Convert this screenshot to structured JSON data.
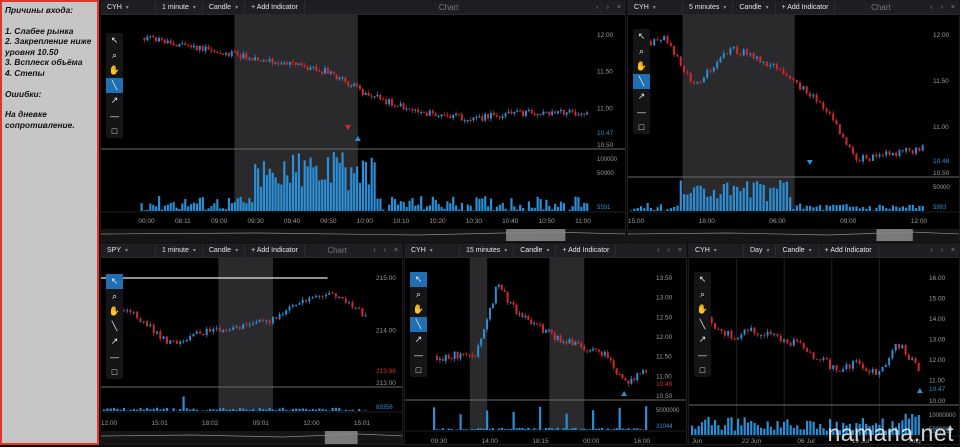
{
  "notes": {
    "heading": "Причины входа:",
    "items": [
      "1. Слабее рынка",
      "2. Закрепление ниже уровня 10.50",
      "3. Всплеск объёма",
      "4. Степы"
    ],
    "errors_heading": "Ошибки:",
    "errors_text": "На дневке сопротивление."
  },
  "panels": [
    {
      "id": "p1",
      "ticker": "CYH",
      "interval": "1 minute",
      "style": "Candle",
      "add": "+ Add Indicator",
      "title": "Chart",
      "prices": [
        "12.00",
        "11.50",
        "11.00",
        "10.50"
      ],
      "last": "10.47",
      "vol_labels": [
        "100000",
        "50000"
      ],
      "vol_last": "5591",
      "times": [
        "00:00",
        "08:11",
        "09:00",
        "09:30",
        "09:40",
        "09:50",
        "10:00",
        "10:10",
        "10:20",
        "10:30",
        "10:40",
        "10:50",
        "11:00"
      ]
    },
    {
      "id": "p2",
      "ticker": "CYH",
      "interval": "5 minutes",
      "style": "Candle",
      "add": "+ Add Indicator",
      "title": "Chart",
      "prices": [
        "12.00",
        "11.50",
        "11.00",
        "10.50"
      ],
      "last": "10.48",
      "vol_labels": [
        "50000"
      ],
      "vol_last": "5993",
      "times": [
        "15:00",
        "18:00",
        "06:00",
        "09:00",
        "12:00"
      ]
    },
    {
      "id": "p3",
      "ticker": "SPY",
      "interval": "1 minute",
      "style": "Candle",
      "add": "+ Add Indicator",
      "title": "Chart",
      "prices": [
        "215.00",
        "214.00",
        "213.00"
      ],
      "last": "213.96",
      "vol_last": "89356",
      "times": [
        "12:00",
        "15:01",
        "18:02",
        "09:01",
        "12:00",
        "15:01"
      ]
    },
    {
      "id": "p4",
      "ticker": "CYH",
      "interval": "15 minutes",
      "style": "Candle",
      "add": "+ Add Indicator",
      "title": "",
      "prices": [
        "13.50",
        "13.00",
        "12.50",
        "12.00",
        "11.50",
        "11.00",
        "10.50"
      ],
      "last": "10.48",
      "vol_labels": [
        "5000000"
      ],
      "vol_last": "31044",
      "times": [
        "09:30",
        "14:00",
        "18:15",
        "00:00",
        "16:00"
      ]
    },
    {
      "id": "p5",
      "ticker": "CYH",
      "interval": "Day",
      "style": "Candle",
      "add": "+ Add Indicator",
      "title": "",
      "prices": [
        "16.00",
        "15.00",
        "14.00",
        "13.00",
        "12.00",
        "11.00",
        "10.00"
      ],
      "last": "10.47",
      "vol_labels": [
        "10000000",
        "5000000"
      ],
      "vol_last": "3297716",
      "times": [
        "Jun",
        "22 Jun",
        "06 Jul",
        "19 Jul",
        "Aug"
      ]
    }
  ],
  "icons": [
    "cursor-icon",
    "zoom-icon",
    "hand-icon",
    "line-icon",
    "arrow-icon",
    "hline-icon",
    "rect-icon"
  ],
  "watermark": "namana.net",
  "colors": {
    "up": "#2a8fd6",
    "down": "#d5272c",
    "highlight": "#3a3a3a"
  }
}
